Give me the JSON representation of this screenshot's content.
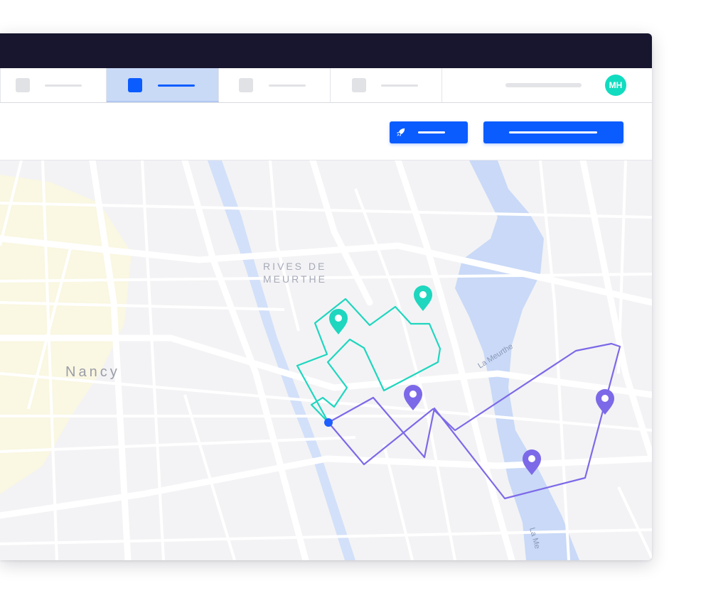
{
  "app": {
    "user_initials": "MH"
  },
  "tabs": [
    {
      "name": "tab-1",
      "active": false
    },
    {
      "name": "tab-2",
      "active": true
    },
    {
      "name": "tab-3",
      "active": false
    },
    {
      "name": "tab-4",
      "active": false
    }
  ],
  "toolbar": {
    "launch_icon": "rocket-icon",
    "launch_label": "",
    "primary_label": ""
  },
  "map": {
    "district_label_line1": "RIVES DE",
    "district_label_line2": "MEURTHE",
    "city_label": "Nancy",
    "river_label": "La Meurthe",
    "river_label_2": "La Me",
    "colors": {
      "route_teal": "#1fd6bf",
      "route_purple": "#7c69e8",
      "origin": "#1e5fff",
      "river": "#c9d9f7",
      "urban_zone": "#fbf8dd"
    },
    "markers": [
      {
        "route": "teal",
        "icon": "map-pin-icon"
      },
      {
        "route": "teal",
        "icon": "map-pin-icon"
      },
      {
        "route": "purple",
        "icon": "map-pin-icon"
      },
      {
        "route": "purple",
        "icon": "map-pin-icon"
      },
      {
        "route": "purple",
        "icon": "map-pin-icon"
      }
    ]
  }
}
